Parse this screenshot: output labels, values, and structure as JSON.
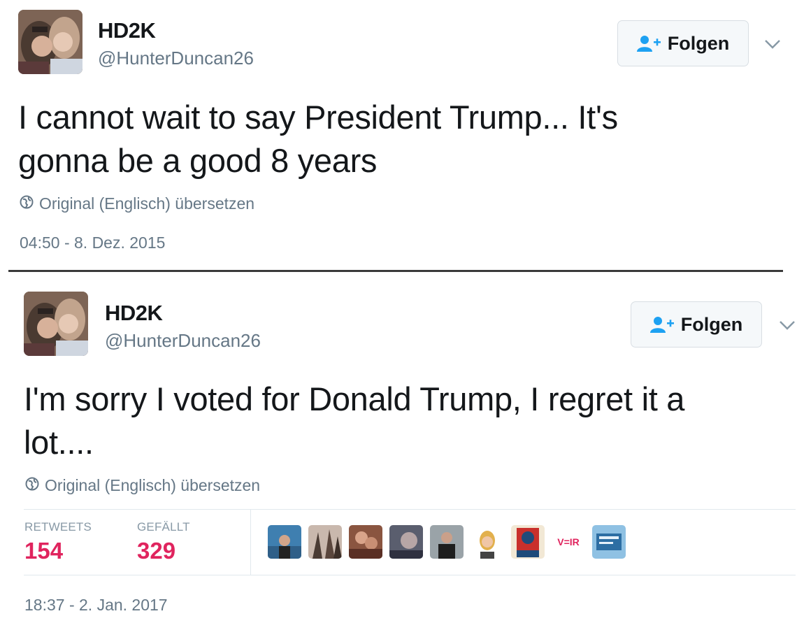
{
  "tweets": [
    {
      "display_name": "HD2K",
      "handle": "@HunterDuncan26",
      "follow_label": "Folgen",
      "text_line1": "I cannot wait to say President Trump... It's",
      "text_line2": "gonna be a good 8 years",
      "translate_label": "Original (Englisch) übersetzen",
      "timestamp": "04:50 - 8. Dez. 2015"
    },
    {
      "display_name": "HD2K",
      "handle": "@HunterDuncan26",
      "follow_label": "Folgen",
      "text_line1": "I'm sorry I voted for Donald Trump, I regret it a",
      "text_line2": "lot....",
      "translate_label": "Original (Englisch) übersetzen",
      "stats": {
        "retweets_label": "RETWEETS",
        "retweets_value": "154",
        "likes_label": "GEFÄLLT",
        "likes_value": "329"
      },
      "liker_avatar_text": "V=IR",
      "timestamp": "18:37 - 2. Jan. 2017"
    }
  ],
  "icons": {
    "follow": "add-user-icon",
    "more": "chevron-down-icon",
    "translate": "globe-icon"
  },
  "colors": {
    "accent": "#1da1f2",
    "likes": "#e0245e",
    "secondary_text": "#657786"
  }
}
